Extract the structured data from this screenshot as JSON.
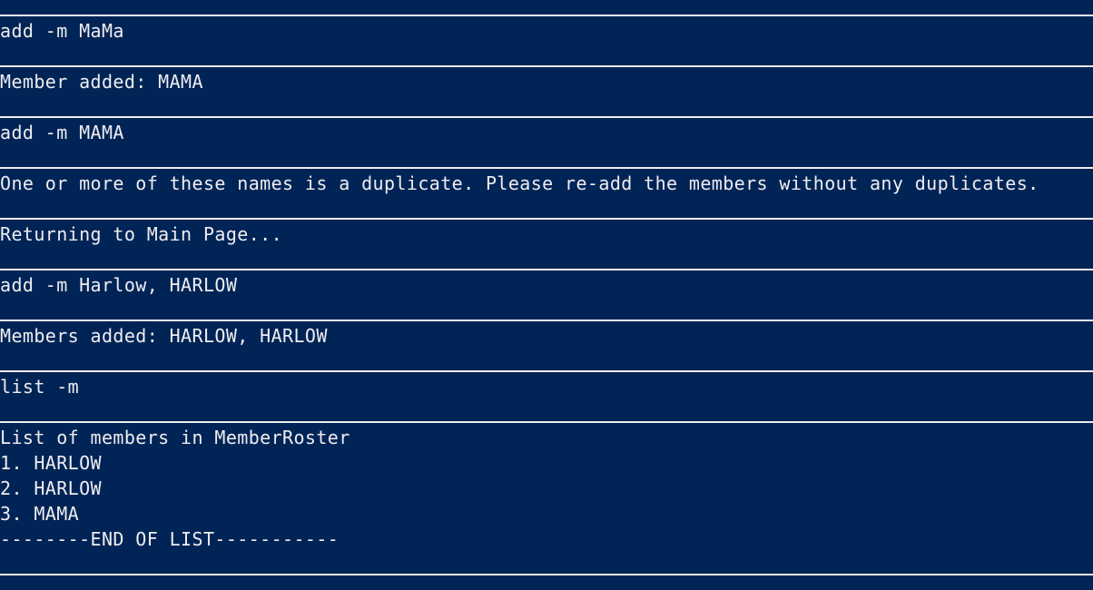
{
  "terminal": {
    "background": "#012456",
    "foreground": "#eeedf0",
    "entries": [
      {
        "kind": "input",
        "text": "add -m MaMa"
      },
      {
        "kind": "output",
        "text": "Member added: MAMA"
      },
      {
        "kind": "input",
        "text": "add -m MAMA"
      },
      {
        "kind": "output",
        "text": "One or more of these names is a duplicate. Please re-add the members without any duplicates."
      },
      {
        "kind": "output",
        "text": "Returning to Main Page..."
      },
      {
        "kind": "input",
        "text": "add -m Harlow, HARLOW"
      },
      {
        "kind": "output",
        "text": "Members added: HARLOW, HARLOW"
      },
      {
        "kind": "input",
        "text": "list -m"
      },
      {
        "kind": "output",
        "lines": [
          "List of members in MemberRoster",
          "1. HARLOW",
          "2. HARLOW",
          "3. MAMA",
          "--------END OF LIST-----------"
        ]
      }
    ]
  }
}
